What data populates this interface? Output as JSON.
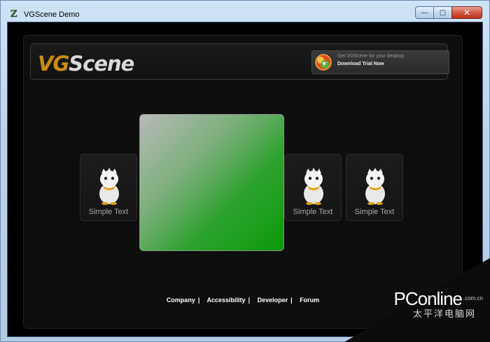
{
  "window": {
    "title": "VGScene Demo",
    "icon": "app-icon",
    "controls": {
      "minimize": "—",
      "maximize": "▢",
      "close": "✕"
    }
  },
  "header": {
    "logo_vg": "VG",
    "logo_scene": "Scene",
    "download": {
      "subtitle": "Get VGScene for your desktop",
      "label": "Download Trial Now",
      "icon": "globe-download-icon"
    }
  },
  "cards": [
    {
      "label": "Simple Text",
      "icon": "bird-mascot-icon"
    },
    {
      "label": "Simple Text",
      "icon": "bird-mascot-icon"
    },
    {
      "label": "Simple Text",
      "icon": "bird-mascot-icon"
    }
  ],
  "colors": {
    "accent": "#c98b12",
    "tile_green": "#0a9a0a",
    "background": "#0e0e0e"
  },
  "footer": {
    "links": [
      "Company",
      "Accessibility",
      "Developer",
      "Forum"
    ],
    "separator": "|"
  },
  "watermark": {
    "brand": "PConline",
    "domain": ".com.cn",
    "chinese": "太平洋电脑网"
  }
}
